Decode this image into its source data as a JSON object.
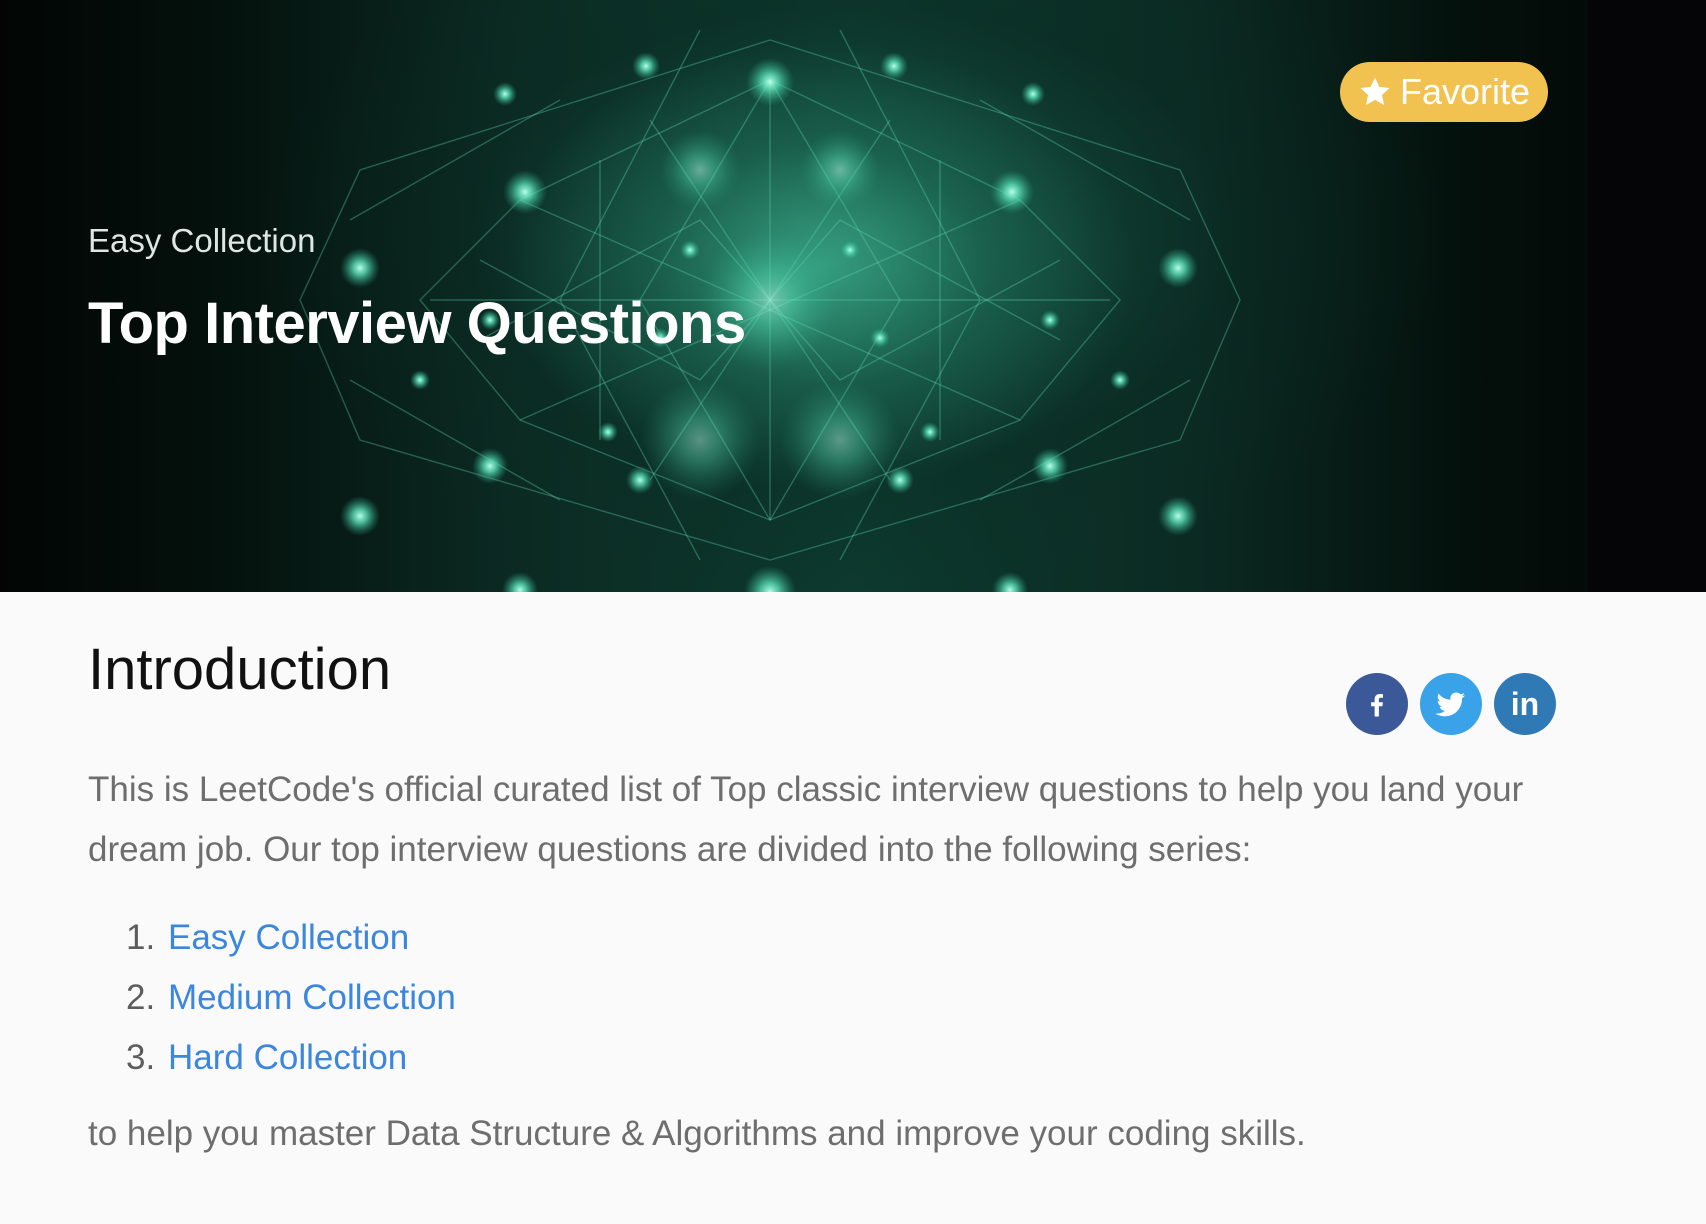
{
  "hero": {
    "subtitle": "Easy Collection",
    "title": "Top Interview Questions",
    "favorite_label": "Favorite",
    "favorite_icon": "star-icon"
  },
  "intro": {
    "heading": "Introduction",
    "paragraph": "This is LeetCode's official curated list of Top classic interview questions to help you land your dream job. Our top interview questions are divided into the following series:",
    "series": [
      {
        "number": "1.",
        "label": "Easy Collection"
      },
      {
        "number": "2.",
        "label": "Medium Collection"
      },
      {
        "number": "3.",
        "label": "Hard Collection"
      }
    ],
    "closing": "to help you master Data Structure & Algorithms and improve your coding skills."
  },
  "share": {
    "facebook_icon": "facebook-icon",
    "twitter_icon": "twitter-icon",
    "linkedin_icon": "linkedin-icon",
    "linkedin_text": "in"
  },
  "colors": {
    "favorite": "#f1c24f",
    "facebook": "#3b5998",
    "twitter": "#3aa2e8",
    "linkedin": "#2f7ab5",
    "link": "#3b86df"
  }
}
